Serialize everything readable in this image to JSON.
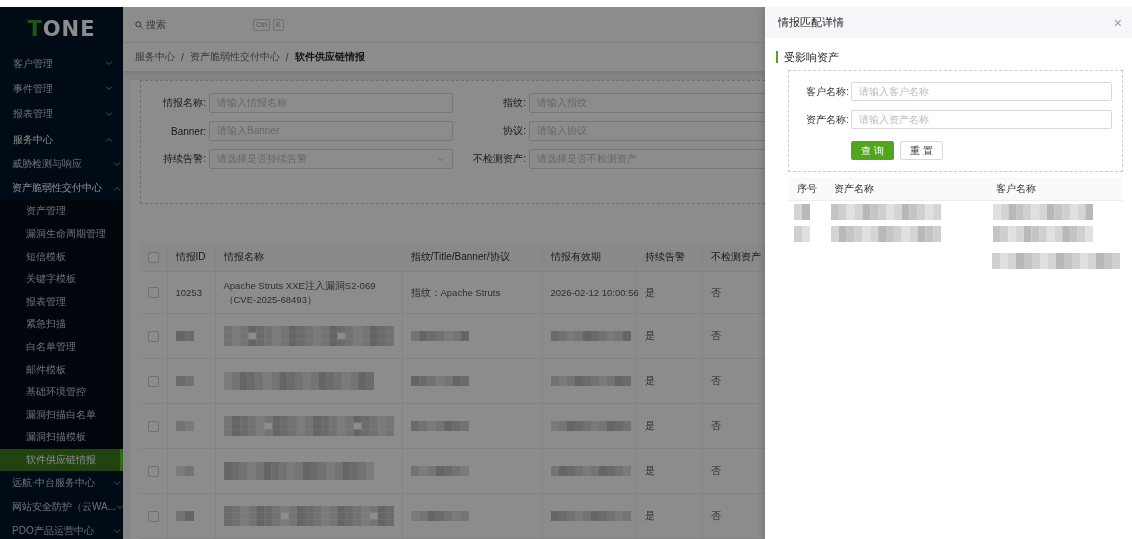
{
  "logo": {
    "mark": "T",
    "text": "ONE"
  },
  "search": {
    "placeholder": "搜索",
    "keys": [
      "Ctrl",
      "K"
    ]
  },
  "sidebar": {
    "items": [
      {
        "label": "客户管理",
        "kind": "group",
        "expanded": false,
        "selected": false
      },
      {
        "label": "事件管理",
        "kind": "group",
        "expanded": false,
        "selected": false
      },
      {
        "label": "报表管理",
        "kind": "group",
        "expanded": false,
        "selected": false
      },
      {
        "label": "服务中心",
        "kind": "group",
        "expanded": true,
        "selected": false,
        "children": [
          {
            "label": "威胁检测与响应",
            "kind": "group",
            "expanded": false,
            "selected": false
          },
          {
            "label": "资产脆弱性交付中心",
            "kind": "group",
            "expanded": true,
            "selected": false,
            "children": [
              {
                "label": "资产管理",
                "kind": "leaf",
                "selected": false
              },
              {
                "label": "漏洞生命周期管理",
                "kind": "leaf",
                "selected": false
              },
              {
                "label": "短信模板",
                "kind": "leaf",
                "selected": false
              },
              {
                "label": "关键字模板",
                "kind": "leaf",
                "selected": false
              },
              {
                "label": "报表管理",
                "kind": "leaf",
                "selected": false
              },
              {
                "label": "紧急扫描",
                "kind": "leaf",
                "selected": false
              },
              {
                "label": "白名单管理",
                "kind": "leaf",
                "selected": false
              },
              {
                "label": "邮件模板",
                "kind": "leaf",
                "selected": false
              },
              {
                "label": "基础环境管控",
                "kind": "leaf",
                "selected": false
              },
              {
                "label": "漏洞扫描白名单",
                "kind": "leaf",
                "selected": false
              },
              {
                "label": "漏洞扫描模板",
                "kind": "leaf",
                "selected": false
              },
              {
                "label": "软件供应链情报",
                "kind": "leaf",
                "selected": true
              }
            ]
          },
          {
            "label": "远航·中台服务中心",
            "kind": "group",
            "expanded": false,
            "selected": false
          },
          {
            "label": "网站安全防护（云WA...",
            "kind": "group",
            "expanded": false,
            "selected": false
          },
          {
            "label": "PDO产品运营中心",
            "kind": "group",
            "expanded": false,
            "selected": false
          }
        ]
      }
    ]
  },
  "breadcrumb": {
    "separator": "/",
    "items": [
      "服务中心",
      "资产脆弱性交付中心",
      "软件供应链情报"
    ]
  },
  "filters": [
    {
      "label": "情报名称:",
      "placeholder": "请输入情报名称",
      "kind": "text"
    },
    {
      "label": "指纹:",
      "placeholder": "请输入指纹",
      "kind": "text"
    },
    {
      "label": "Banner:",
      "placeholder": "请输入Banner",
      "kind": "text"
    },
    {
      "label": "协议:",
      "placeholder": "请输入协议",
      "kind": "text"
    },
    {
      "label": "持续告警:",
      "placeholder": "请选择是否持续告警",
      "kind": "select"
    },
    {
      "label": "不检测资产:",
      "placeholder": "请选择是否不检测资产",
      "kind": "text"
    }
  ],
  "table": {
    "select_all": {
      "checked": false
    },
    "columns": [
      "情报ID",
      "情报名称",
      "指纹/Title/Banner/协议",
      "情报有效期",
      "持续告警",
      "不检测资产"
    ],
    "rows": [
      {
        "checked": false,
        "redacted": false,
        "id": "10253",
        "name": "Apache Struts XXE注入漏洞S2-069（CVE-2025-68493）",
        "fingerprint": "指纹：Apache Struts",
        "validity": "2026-02-12 10:00:56",
        "alert": "是",
        "exclude": "否"
      },
      {
        "checked": false,
        "redacted": true,
        "alert": "是",
        "exclude": "否"
      },
      {
        "checked": false,
        "redacted": true,
        "alert": "是",
        "exclude": "否"
      },
      {
        "checked": false,
        "redacted": true,
        "alert": "是",
        "exclude": "否"
      },
      {
        "checked": false,
        "redacted": true,
        "alert": "是",
        "exclude": "否"
      },
      {
        "checked": false,
        "redacted": true,
        "alert": "是",
        "exclude": "否"
      }
    ]
  },
  "drawer": {
    "title": "情报匹配详情",
    "close": "×",
    "section_title": "受影响资产",
    "fields": [
      {
        "label": "客户名称:",
        "placeholder": "请输入客户名称"
      },
      {
        "label": "资产名称:",
        "placeholder": "请输入资产名称"
      }
    ],
    "buttons": [
      {
        "label": "查 询",
        "kind": "primary"
      },
      {
        "label": "重 置",
        "kind": "default"
      }
    ],
    "table": {
      "columns": [
        "序号",
        "资产名称",
        "客户名称"
      ],
      "rows": [
        {
          "redacted": true
        },
        {
          "redacted": true
        }
      ]
    }
  }
}
